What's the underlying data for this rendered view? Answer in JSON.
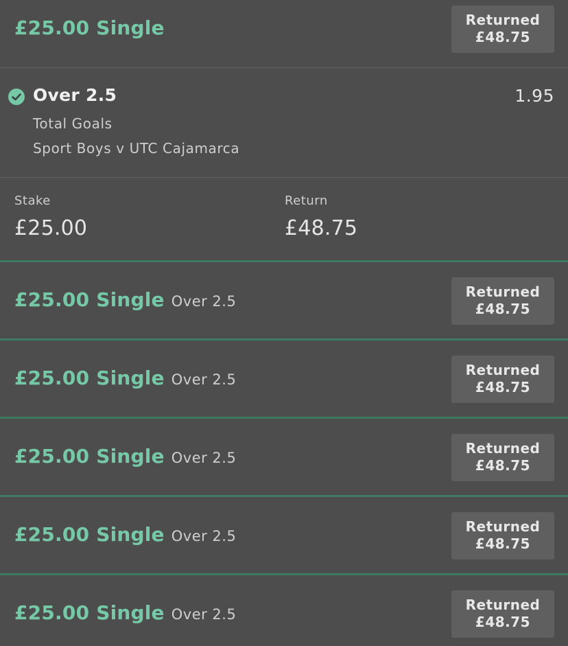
{
  "expanded_bet": {
    "title": "£25.00 Single",
    "status": {
      "label": "Returned",
      "amount": "£48.75"
    },
    "selection": {
      "name": "Over 2.5",
      "odds": "1.95",
      "market": "Total Goals",
      "event": "Sport Boys v UTC Cajamarca"
    },
    "stake": {
      "label": "Stake",
      "value": "£25.00"
    },
    "return": {
      "label": "Return",
      "value": "£48.75"
    }
  },
  "bets": [
    {
      "title": "£25.00 Single",
      "selection": "Over 2.5",
      "status_label": "Returned",
      "status_amount": "£48.75"
    },
    {
      "title": "£25.00 Single",
      "selection": "Over 2.5",
      "status_label": "Returned",
      "status_amount": "£48.75"
    },
    {
      "title": "£25.00 Single",
      "selection": "Over 2.5",
      "status_label": "Returned",
      "status_amount": "£48.75"
    },
    {
      "title": "£25.00 Single",
      "selection": "Over 2.5",
      "status_label": "Returned",
      "status_amount": "£48.75"
    },
    {
      "title": "£25.00 Single",
      "selection": "Over 2.5",
      "status_label": "Returned",
      "status_amount": "£48.75"
    }
  ],
  "icons": {
    "won": "check-circle-icon"
  },
  "colors": {
    "accent": "#75c9a7",
    "background": "#4d4d4d",
    "badge": "#5f5f5f",
    "divider_green": "#3f7a63"
  }
}
